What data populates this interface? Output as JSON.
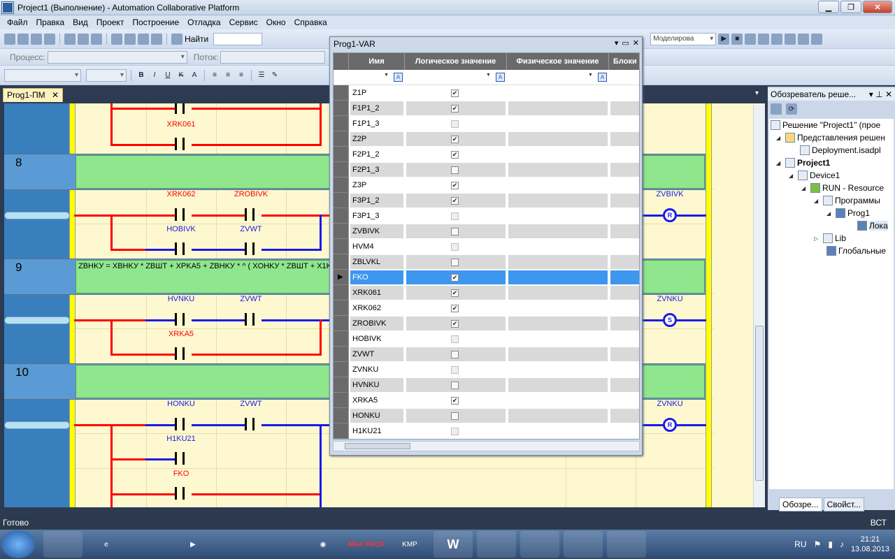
{
  "window": {
    "title": "Project1 (Выполнение) - Automation Collaborative Platform"
  },
  "menu": [
    "Файл",
    "Правка",
    "Вид",
    "Проект",
    "Построение",
    "Отладка",
    "Сервис",
    "Окно",
    "Справка"
  ],
  "toolbar": {
    "find_label": "Найти",
    "process_label": "Процесс:",
    "stream_label": "Поток:",
    "simulation_combo": "Моделирова"
  },
  "doc_tab": {
    "label": "Prog1-ПМ",
    "close": "✕"
  },
  "ladder": {
    "rungs": [
      {
        "number": "8"
      },
      {
        "number": "9",
        "comment": "ZBHKУ = XBHKУ * ZBШТ + XPKA5 + ZBHKУ * ^ ( XOHKУ * ZBШТ + X1KУ"
      },
      {
        "number": "10"
      }
    ],
    "labels": {
      "xrk061": "XRK061",
      "xrk062": "XRK062",
      "zrobivk": "ZROBIVK",
      "hobivk": "HOBIVK",
      "zvwt1": "ZVWT",
      "zvbivk": "ZVBIVK",
      "hvnku": "HVNKU",
      "zvwt2": "ZVWT",
      "xrka5": "XRKA5",
      "zvnku1": "ZVNKU",
      "honku": "HONKU",
      "zvwt3": "ZVWT",
      "h1ku21": "H1KU21",
      "fko": "FKO",
      "zvnku2": "ZVNKU"
    },
    "coils": {
      "c1": "R",
      "c2": "S",
      "c3": "R"
    }
  },
  "var_window": {
    "title": "Prog1-VAR",
    "columns": [
      "Имя",
      "Логическое значение",
      "Физическое значение",
      "Блоки"
    ],
    "rows": [
      {
        "name": "Z1P",
        "checked": true,
        "enabled": true
      },
      {
        "name": "F1P1_2",
        "checked": true,
        "enabled": true
      },
      {
        "name": "F1P1_3",
        "checked": false,
        "enabled": false
      },
      {
        "name": "Z2P",
        "checked": true,
        "enabled": true
      },
      {
        "name": "F2P1_2",
        "checked": true,
        "enabled": true
      },
      {
        "name": "F2P1_3",
        "checked": false,
        "enabled": true
      },
      {
        "name": "Z3P",
        "checked": true,
        "enabled": true
      },
      {
        "name": "F3P1_2",
        "checked": true,
        "enabled": true
      },
      {
        "name": "F3P1_3",
        "checked": false,
        "enabled": false
      },
      {
        "name": "ZVBIVK",
        "checked": false,
        "enabled": true
      },
      {
        "name": "HVM4",
        "checked": false,
        "enabled": false
      },
      {
        "name": "ZBLVKL",
        "checked": false,
        "enabled": true
      },
      {
        "name": "FKO",
        "checked": true,
        "enabled": true,
        "selected": true
      },
      {
        "name": "XRK061",
        "checked": true,
        "enabled": true
      },
      {
        "name": "XRK062",
        "checked": true,
        "enabled": true
      },
      {
        "name": "ZROBIVK",
        "checked": true,
        "enabled": true
      },
      {
        "name": "HOBIVK",
        "checked": false,
        "enabled": false
      },
      {
        "name": "ZVWT",
        "checked": false,
        "enabled": true
      },
      {
        "name": "ZVNKU",
        "checked": false,
        "enabled": false
      },
      {
        "name": "HVNKU",
        "checked": false,
        "enabled": true
      },
      {
        "name": "XRKA5",
        "checked": true,
        "enabled": true
      },
      {
        "name": "HONKU",
        "checked": false,
        "enabled": true
      },
      {
        "name": "H1KU21",
        "checked": false,
        "enabled": false
      }
    ]
  },
  "solution_explorer": {
    "title": "Обозреватель реше...",
    "nodes": [
      {
        "label": "Решение \"Project1\"  (прое"
      },
      {
        "label": "Представления решен"
      },
      {
        "label": "Deployment.isadpl"
      },
      {
        "label": "Project1",
        "bold": true
      },
      {
        "label": "Device1"
      },
      {
        "label": "RUN - Resource"
      },
      {
        "label": "Программы"
      },
      {
        "label": "Prog1"
      },
      {
        "label": "Лока"
      },
      {
        "label": "Lib"
      },
      {
        "label": "Глобальные"
      }
    ],
    "tabs": [
      "Обозре...",
      "Свойст..."
    ]
  },
  "status": {
    "left": "Готово",
    "right": "ВСТ"
  },
  "taskbar": {
    "lang": "RU",
    "time": "21:21",
    "date": "13.08.2013",
    "apps": [
      "MAX PACK",
      "KMP",
      "W"
    ]
  },
  "colors": {
    "rung_wire": "#ff0000",
    "energized_wire": "#1a1ae8",
    "rung_comment_bg": "#8fe68d",
    "selection": "#3d97ef"
  }
}
